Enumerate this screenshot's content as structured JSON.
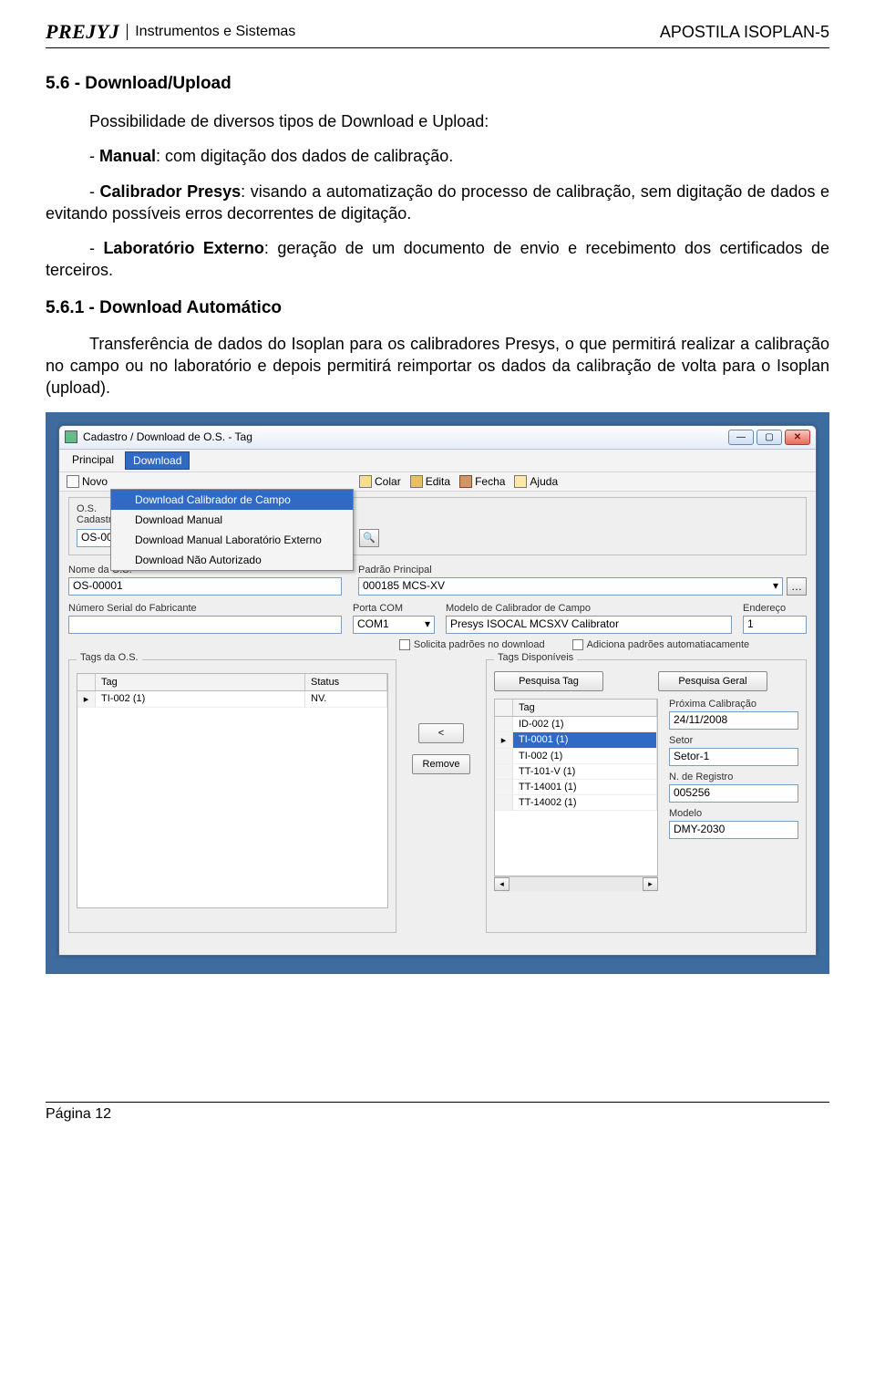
{
  "header": {
    "brand_logo": "PREJYJ",
    "brand_text": "Instrumentos e Sistemas",
    "doc_title": "APOSTILA ISOPLAN-5"
  },
  "section_title": "5.6 - Download/Upload",
  "intro": "Possibilidade de diversos tipos de Download e Upload:",
  "bullet1_prefix": "- ",
  "bullet1_term": "Manual",
  "bullet1_rest": ": com digitação dos dados de calibração.",
  "bullet2_prefix": "- ",
  "bullet2_term": "Calibrador Presys",
  "bullet2_rest": ": visando a automatização do processo de calibração, sem digitação de dados e evitando possíveis erros decorrentes de digitação.",
  "bullet3_prefix": "- ",
  "bullet3_term": "Laboratório Externo",
  "bullet3_rest": ": geração de um documento de envio e recebimento dos certificados de terceiros.",
  "sub_title": "5.6.1 - Download Automático",
  "sub_para": "Transferência de dados do Isoplan para os calibradores Presys, o que permitirá realizar a calibração no campo ou no laboratório e depois permitirá reimportar os dados da calibração de volta para o Isoplan (upload).",
  "win": {
    "title": "Cadastro / Download de O.S. - Tag",
    "menus": {
      "principal": "Principal",
      "download": "Download"
    },
    "dropdown": {
      "items": [
        "Download Calibrador de Campo",
        "Download Manual",
        "Download Manual Laboratório Externo",
        "Download Não Autorizado"
      ]
    },
    "toolbar": {
      "novo": "Novo",
      "colar": "Colar",
      "edita": "Edita",
      "fecha": "Fecha",
      "ajuda": "Ajuda"
    },
    "os_cadastr_label": "O.S. Cadastr",
    "os_cadastr_value": "OS-00001",
    "row2": {
      "nome_label": "Nome da O.S.",
      "nome_value": "OS-00001",
      "padrao_label": "Padrão Principal",
      "padrao_value": "000185 MCS-XV"
    },
    "row3": {
      "serial_label": "Número Serial do Fabricante",
      "serial_value": "",
      "porta_label": "Porta COM",
      "porta_value": "COM1",
      "modelo_label": "Modelo de Calibrador de Campo",
      "modelo_value": "Presys ISOCAL MCSXV Calibrator",
      "endereco_label": "Endereço",
      "endereco_value": "1"
    },
    "checks": {
      "c1": "Solicita padrões no download",
      "c2": "Adiciona padrões automatiacamente"
    },
    "left_group": {
      "legend": "Tags da O.S.",
      "col_tag": "Tag",
      "col_status": "Status",
      "rows": [
        {
          "tag": "TI-002 (1)",
          "status": "NV."
        }
      ],
      "btn_lt": "<",
      "btn_remove": "Remove"
    },
    "right_group": {
      "legend": "Tags Disponíveis",
      "btn_pesq_tag": "Pesquisa Tag",
      "btn_pesq_geral": "Pesquisa Geral",
      "col_tag": "Tag",
      "rows": [
        "ID-002 (1)",
        "TI-0001 (1)",
        "TI-002 (1)",
        "TT-101-V (1)",
        "TT-14001 (1)",
        "TT-14002 (1)"
      ],
      "side": {
        "prox_label": "Próxima Calibração",
        "prox_value": "24/11/2008",
        "setor_label": "Setor",
        "setor_value": "Setor-1",
        "reg_label": "N. de Registro",
        "reg_value": "005256",
        "modelo_label": "Modelo",
        "modelo_value": "DMY-2030"
      }
    }
  },
  "footer": {
    "page": "Página 12"
  }
}
